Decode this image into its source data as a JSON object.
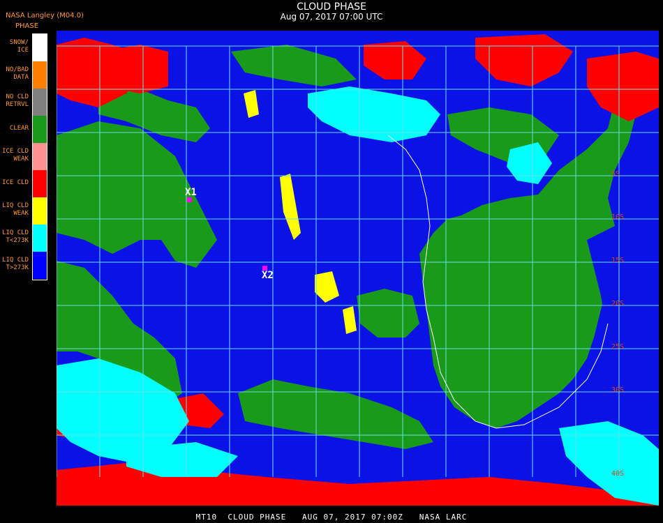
{
  "header": {
    "title": "CLOUD PHASE",
    "subtitle": "Aug 07, 2017 07:00 UTC",
    "producer": "NASA Langley (M04.0)"
  },
  "legend": {
    "title": "PHASE",
    "items": [
      {
        "label": "SNOW/\nICE",
        "color": "#ffffff"
      },
      {
        "label": "NO/BAD\nDATA",
        "color": "#ff7f00"
      },
      {
        "label": "NO CLD\nRETRVL",
        "color": "#808080"
      },
      {
        "label": "CLEAR",
        "color": "#1a9a1a"
      },
      {
        "label": "ICE CLD\nWEAK",
        "color": "#ff9090"
      },
      {
        "label": "ICE CLD",
        "color": "#ff0000"
      },
      {
        "label": "LIQ CLD\nWEAK",
        "color": "#ffff00"
      },
      {
        "label": "LIQ CLD\nT<273K",
        "color": "#00ffff"
      },
      {
        "label": "LIQ CLD\nT>273K",
        "color": "#0000ff"
      }
    ]
  },
  "markers": [
    {
      "label": "X1"
    },
    {
      "label": "X2"
    }
  ],
  "lat_labels": [
    "5S",
    "10S",
    "15S",
    "20S",
    "25S",
    "30S",
    "40S"
  ],
  "footer": "MT10  CLOUD PHASE   AUG 07, 2017 07:00Z   NASA LARC"
}
